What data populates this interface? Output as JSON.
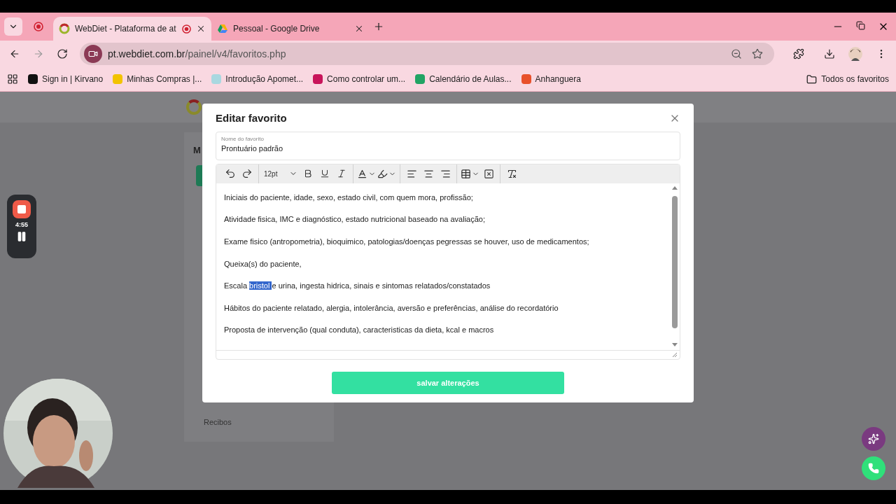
{
  "browser": {
    "tabs": [
      {
        "title": "WebDiet - Plataforma de at",
        "selected": true,
        "recording": true
      },
      {
        "title": "Pessoal - Google Drive",
        "selected": false,
        "recording": false
      }
    ],
    "url": {
      "host": "pt.webdiet.com.br",
      "path": "/painel/v4/favoritos.php"
    },
    "bookmarks": [
      {
        "title": "Sign in | Kirvano",
        "color": "#111111"
      },
      {
        "title": "Minhas Compras |...",
        "color": "#f2c300"
      },
      {
        "title": "Introdução Apomet...",
        "color": "#a9d8e0"
      },
      {
        "title": "Como controlar um...",
        "color": "#c8145a"
      },
      {
        "title": "Calendário de Aulas...",
        "color": "#21a464"
      },
      {
        "title": "Anhanguera",
        "color": "#e8502a"
      }
    ],
    "all_bookmarks": "Todos os favoritos"
  },
  "recorder": {
    "time": "4:55"
  },
  "page": {
    "panel_heading": "M",
    "menu_items": [
      "Recibos"
    ]
  },
  "modal": {
    "title": "Editar favorito",
    "name_field": {
      "label": "Nome do favorito",
      "value": "Prontuário padrão"
    },
    "editor": {
      "font_size": "12pt",
      "paragraphs": [
        [
          {
            "text": "Iniciais do paciente, idade, sexo, estado civil, com quem mora, profissão;",
            "selected": false
          }
        ],
        [
          {
            "text": "Atividade fisica, IMC e diagnóstico, estado nutricional baseado na avaliação;",
            "selected": false
          }
        ],
        [
          {
            "text": "Exame fisico (antropometria), bioquimico, patologias/doenças pegressas se houver, uso de medicamentos;",
            "selected": false
          }
        ],
        [
          {
            "text": "Queixa(s) do paciente,",
            "selected": false
          }
        ],
        [
          {
            "text": "Escala ",
            "selected": false
          },
          {
            "text": "bristol ",
            "selected": true
          },
          {
            "text": "e urina, ingesta hidrica, sinais e sintomas relatados/constatados",
            "selected": false
          }
        ],
        [
          {
            "text": "Hábitos do paciente relatado, alergia, intolerância, aversão e preferências, análise do recordatório",
            "selected": false
          }
        ],
        [
          {
            "text": "Proposta de intervenção (qual conduta), caracteristicas da dieta, kcal e macros",
            "selected": false
          }
        ]
      ]
    },
    "save_button": "salvar alterações"
  }
}
